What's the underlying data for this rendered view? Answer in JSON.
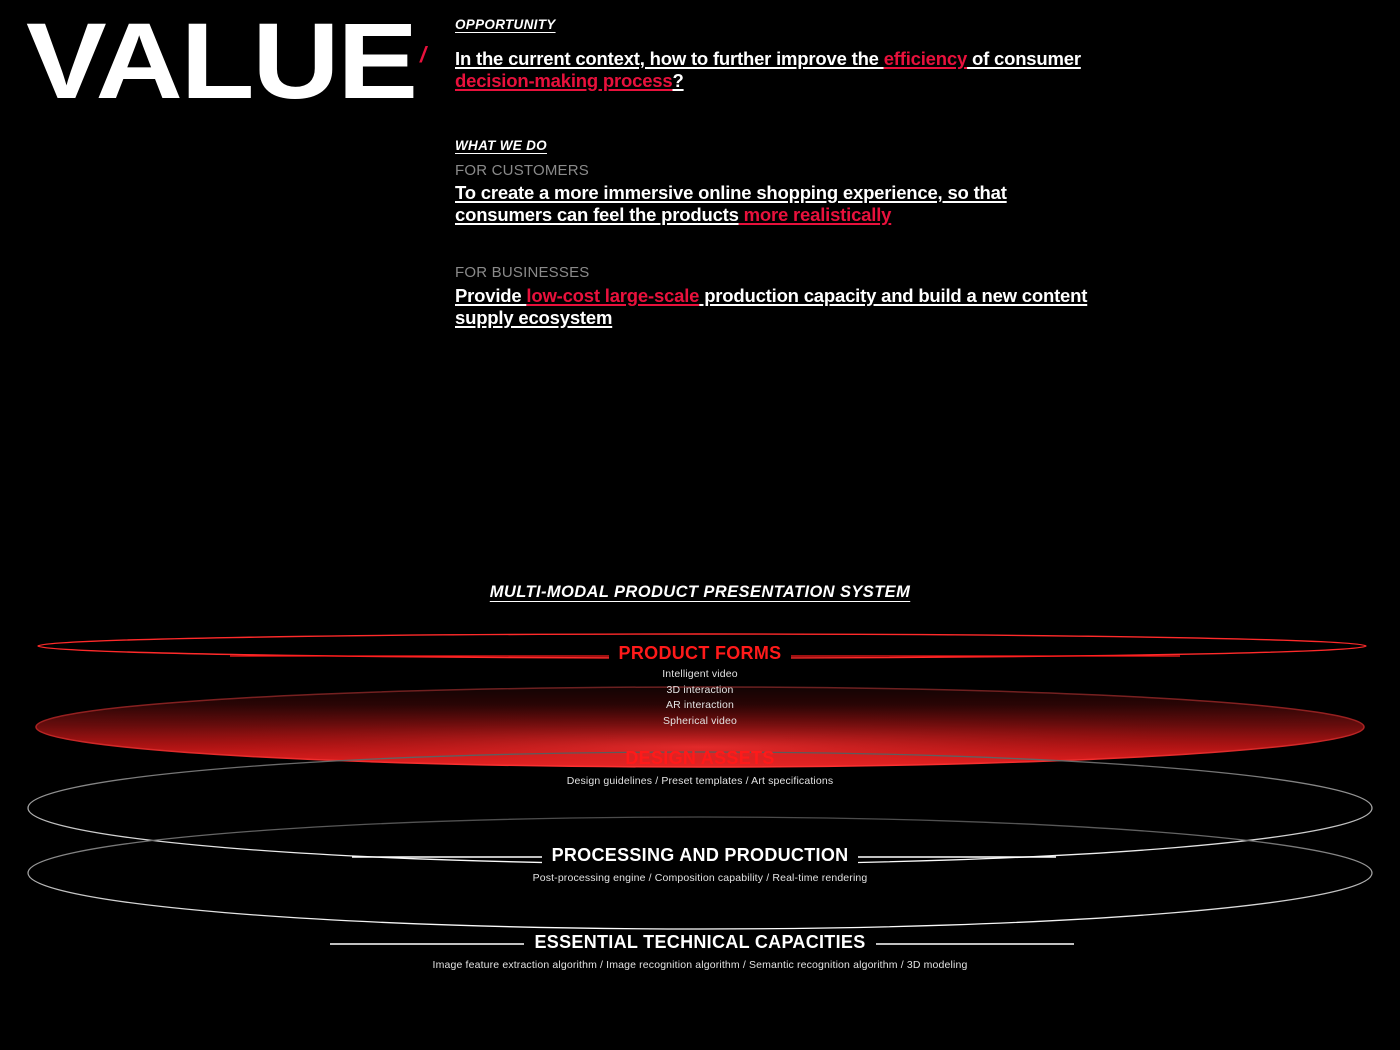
{
  "page": {
    "title": "VALUE",
    "slash": "/",
    "accent_red": "#E8113C",
    "bright_red": "#FF1A1A",
    "background": "#000000"
  },
  "opportunity": {
    "kicker": "OPPORTUNITY",
    "headline_parts": [
      {
        "text": "In the current context, how to further improve the ",
        "color": "white"
      },
      {
        "text": "efficiency",
        "color": "red"
      },
      {
        "text": " of consumer ",
        "color": "white"
      },
      {
        "text": "decision-making process",
        "color": "red"
      },
      {
        "text": "?",
        "color": "white"
      }
    ],
    "headline_plain": "In the current context, how to further improve the efficiency of consumer decision-making process?"
  },
  "what_we_do": {
    "kicker": "WHAT WE DO",
    "groups": [
      {
        "label": "FOR CUSTOMERS",
        "headline_plain": "To create a more immersive online shopping experience, so that consumers can feel the products more realistically",
        "parts": [
          {
            "text": "To create a more immersive online shopping experience, so that consumers can feel the products",
            "color": "white"
          },
          {
            "text": " more realistically",
            "color": "red"
          }
        ]
      },
      {
        "label": "FOR BUSINESSES",
        "headline_plain": "Provide low-cost large-scale production capacity and build a new content supply ecosystem",
        "parts": [
          {
            "text": "Provide ",
            "color": "white"
          },
          {
            "text": "low-cost large-scale",
            "color": "red"
          },
          {
            "text": " production capacity and build a new content supply ecosystem",
            "color": "white"
          }
        ]
      }
    ]
  },
  "diagram": {
    "title": "MULTI-MODAL PRODUCT PRESENTATION SYSTEM",
    "layers": [
      {
        "name": "PRODUCT FORMS",
        "color": "#FF1A1A",
        "items": [
          "Intelligent video",
          "3D interaction",
          "AR interaction",
          "Spherical video"
        ],
        "items_text": "Intelligent video\n3D interaction\nAR interaction\nSpherical video"
      },
      {
        "name": "DESIGN ASSETS",
        "color": "#FF1A1A",
        "items": [
          "Design guidelines",
          "Preset templates",
          "Art specifications"
        ],
        "items_text": "Design guidelines / Preset templates / Art specifications"
      },
      {
        "name": "PROCESSING AND PRODUCTION",
        "color": "#FFFFFF",
        "items": [
          "Post-processing engine",
          "Composition capability",
          "Real-time rendering"
        ],
        "items_text": "Post-processing engine / Composition capability / Real-time rendering"
      },
      {
        "name": "ESSENTIAL TECHNICAL CAPACITIES",
        "color": "#FFFFFF",
        "items": [
          "Image feature extraction algorithm",
          "Image recognition algorithm",
          "Semantic recognition algorithm",
          "3D modeling"
        ],
        "items_text": "Image feature extraction algorithm / Image recognition algorithm / Semantic recognition algorithm / 3D modeling"
      }
    ]
  }
}
